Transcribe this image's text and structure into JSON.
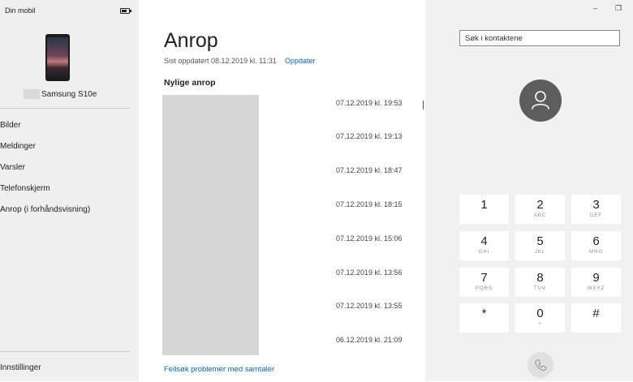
{
  "sidebar": {
    "title": "Din mobil",
    "device_name": "Samsung S10e",
    "items": [
      {
        "label": "Bilder"
      },
      {
        "label": "Meldinger"
      },
      {
        "label": "Varsler"
      },
      {
        "label": "Telefonskjerm"
      },
      {
        "label": "Anrop (i forhåndsvisning)"
      }
    ],
    "settings_label": "Innstillinger"
  },
  "main": {
    "title": "Anrop",
    "updated": "Sist oppdatert 08.12.2019 kl. 11:31",
    "update_link": "Oppdater",
    "recent_heading": "Nylige anrop",
    "calls": [
      {
        "time": "07.12.2019 kl. 19:53"
      },
      {
        "time": "07.12.2019 kl. 19:13"
      },
      {
        "time": "07.12.2019 kl. 18:47"
      },
      {
        "time": "07.12.2019 kl. 18:15"
      },
      {
        "time": "07.12.2019 kl. 15:06"
      },
      {
        "time": "07.12.2019 kl. 13:56"
      },
      {
        "time": "07.12.2019 kl. 13:55"
      },
      {
        "time": "06.12.2019 kl. 21:09"
      }
    ],
    "troubleshoot_link": "Feilsøk problemer med samtaler"
  },
  "dialer": {
    "search_placeholder": "Søk i kontaktene",
    "keys": [
      {
        "digit": "1",
        "letters": ""
      },
      {
        "digit": "2",
        "letters": "ABC"
      },
      {
        "digit": "3",
        "letters": "DEF"
      },
      {
        "digit": "4",
        "letters": "GHI"
      },
      {
        "digit": "5",
        "letters": "JKL"
      },
      {
        "digit": "6",
        "letters": "MNO"
      },
      {
        "digit": "7",
        "letters": "PQRS"
      },
      {
        "digit": "8",
        "letters": "TUV"
      },
      {
        "digit": "9",
        "letters": "WXYZ"
      },
      {
        "digit": "*",
        "letters": ""
      },
      {
        "digit": "0",
        "letters": "+"
      },
      {
        "digit": "#",
        "letters": ""
      }
    ],
    "window_controls": {
      "minimize": "–",
      "restore": "❐"
    }
  },
  "icons": {
    "battery": "battery-icon",
    "avatar": "contact-avatar-icon",
    "call": "phone-call-icon"
  },
  "colors": {
    "sidebar_bg": "#efefef",
    "dialer_bg": "#f1f1f1",
    "link": "#0067b8",
    "avatar": "#5d5d5d"
  }
}
